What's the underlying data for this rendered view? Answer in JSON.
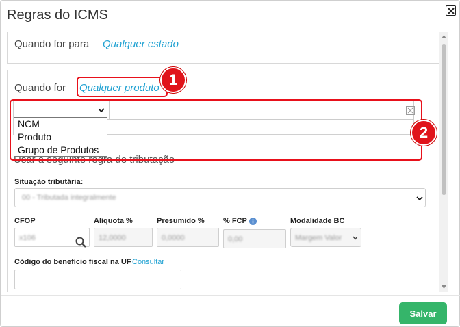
{
  "dialog": {
    "title": "Regras do ICMS"
  },
  "destination": {
    "label": "Quando for para",
    "value": "Qualquer estado"
  },
  "product": {
    "label": "Quando for",
    "value": "Qualquer produto"
  },
  "filter": {
    "select_value": "",
    "options": [
      "NCM",
      "Produto",
      "Grupo de Produtos"
    ]
  },
  "rule": {
    "label": "Usar a seguinte regra de tributação"
  },
  "situation": {
    "label": "Situação tributária:",
    "value": "00 - Tributada integralmente"
  },
  "fields": {
    "cfop_label": "CFOP",
    "cfop_value": "x106",
    "aliquota_label": "Alíquota %",
    "aliquota_value": "12,0000",
    "presumido_label": "Presumido %",
    "presumido_value": "0,0000",
    "fcp_label": "% FCP",
    "fcp_value": "0,00",
    "modalidade_label": "Modalidade BC",
    "modalidade_value": "Margem Valor"
  },
  "beneficio": {
    "label": "Código do benefício fiscal na UF",
    "link": "Consultar",
    "value": ""
  },
  "annotations": {
    "badge1": "1",
    "badge2": "2",
    "color": "#e0141b"
  },
  "footer": {
    "save_label": "Salvar",
    "save_color": "#35b56a"
  },
  "colors": {
    "link": "#1fa1d2"
  }
}
